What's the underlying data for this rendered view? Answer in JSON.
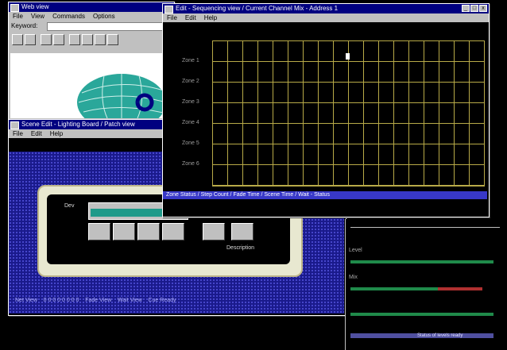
{
  "browser": {
    "title": "Web view",
    "menu": [
      "File",
      "View",
      "Commands",
      "Options"
    ],
    "address_label": "Keyword:",
    "address_value": ""
  },
  "editor": {
    "title": "Edit - Sequencing view / Current Channel Mix - Address 1",
    "menu": [
      "File",
      "Edit",
      "Help"
    ],
    "rows": [
      "Zone 1",
      "Zone 2",
      "Zone 3",
      "Zone 4",
      "Zone 5",
      "Zone 6"
    ],
    "status": "Zone Status / Step Count / Fade Time / Scene Time / Wait - Status"
  },
  "console": {
    "title": "Scene Edit - Lighting Board / Patch view",
    "menu": [
      "File",
      "Edit",
      "Help"
    ],
    "device_label": "Dev",
    "bottom_label": "Description",
    "status": "Net View    0 0 0 0 0 0 0 0    Fade View    Wait View    Cue Ready"
  },
  "meters": {
    "labels": [
      "Level",
      "Mix",
      "",
      ""
    ],
    "footer": "Status of levels ready"
  },
  "colors": {
    "title_bar": "#000080",
    "window_face": "#c0c0c0",
    "grid_line": "#b8aa48",
    "meter_green": "#1f8a4a",
    "meter_red": "#b03030",
    "meter_purple": "#5050a0"
  }
}
